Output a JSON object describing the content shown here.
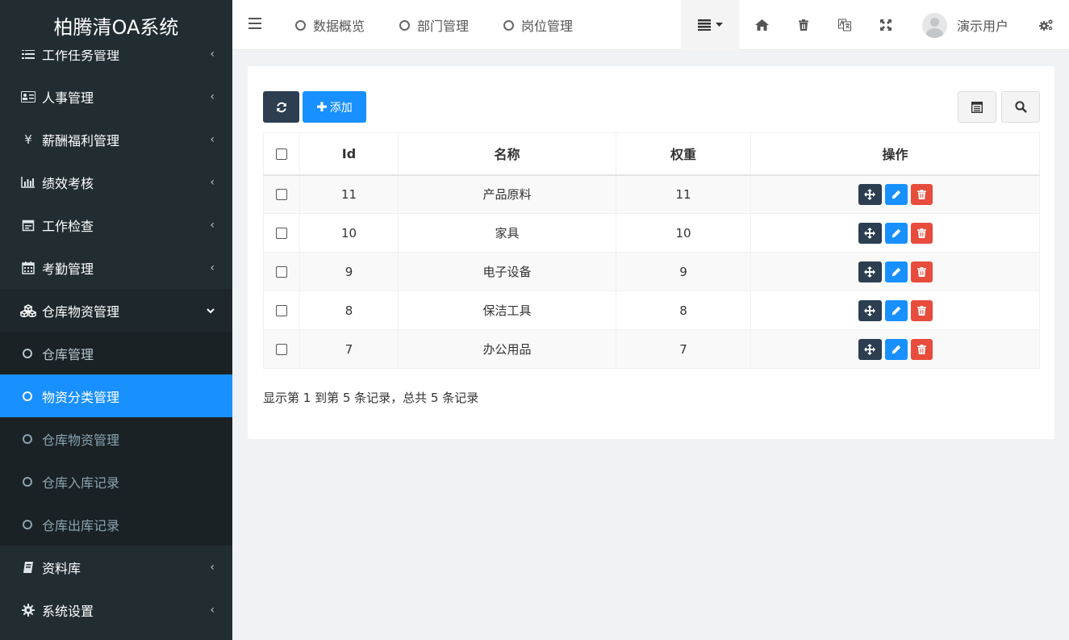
{
  "app": {
    "title": "柏腾清OA系统"
  },
  "sidebar": {
    "items": [
      {
        "label": "工作任务管理",
        "icon": "list-icon"
      },
      {
        "label": "人事管理",
        "icon": "id-card-icon"
      },
      {
        "label": "薪酬福利管理",
        "icon": "yen-icon"
      },
      {
        "label": "绩效考核",
        "icon": "bar-chart-icon"
      },
      {
        "label": "工作检查",
        "icon": "calendar-check-icon"
      },
      {
        "label": "考勤管理",
        "icon": "calendar-icon"
      },
      {
        "label": "仓库物资管理",
        "icon": "cubes-icon"
      }
    ],
    "subitems": [
      {
        "label": "仓库管理"
      },
      {
        "label": "物资分类管理"
      },
      {
        "label": "仓库物资管理"
      },
      {
        "label": "仓库入库记录"
      },
      {
        "label": "仓库出库记录"
      }
    ],
    "bottom_items": [
      {
        "label": "资料库",
        "icon": "book-icon"
      },
      {
        "label": "系统设置",
        "icon": "gear-icon"
      }
    ]
  },
  "topbar": {
    "tabs": [
      {
        "label": "数据概览"
      },
      {
        "label": "部门管理"
      },
      {
        "label": "岗位管理"
      }
    ],
    "user_name": "演示用户"
  },
  "toolbar": {
    "add_label": "添加"
  },
  "table": {
    "columns": [
      "Id",
      "名称",
      "权重",
      "操作"
    ],
    "rows": [
      {
        "id": "11",
        "name": "产品原料",
        "weight": "11"
      },
      {
        "id": "10",
        "name": "家具",
        "weight": "10"
      },
      {
        "id": "9",
        "name": "电子设备",
        "weight": "9"
      },
      {
        "id": "8",
        "name": "保洁工具",
        "weight": "8"
      },
      {
        "id": "7",
        "name": "办公用品",
        "weight": "7"
      }
    ]
  },
  "pagination": {
    "summary": "显示第 1 到第 5 条记录，总共 5 条记录"
  },
  "colors": {
    "sidebar_bg": "#222d32",
    "primary": "#1890ff",
    "dark": "#2c3e50",
    "danger": "#e74c3c"
  }
}
